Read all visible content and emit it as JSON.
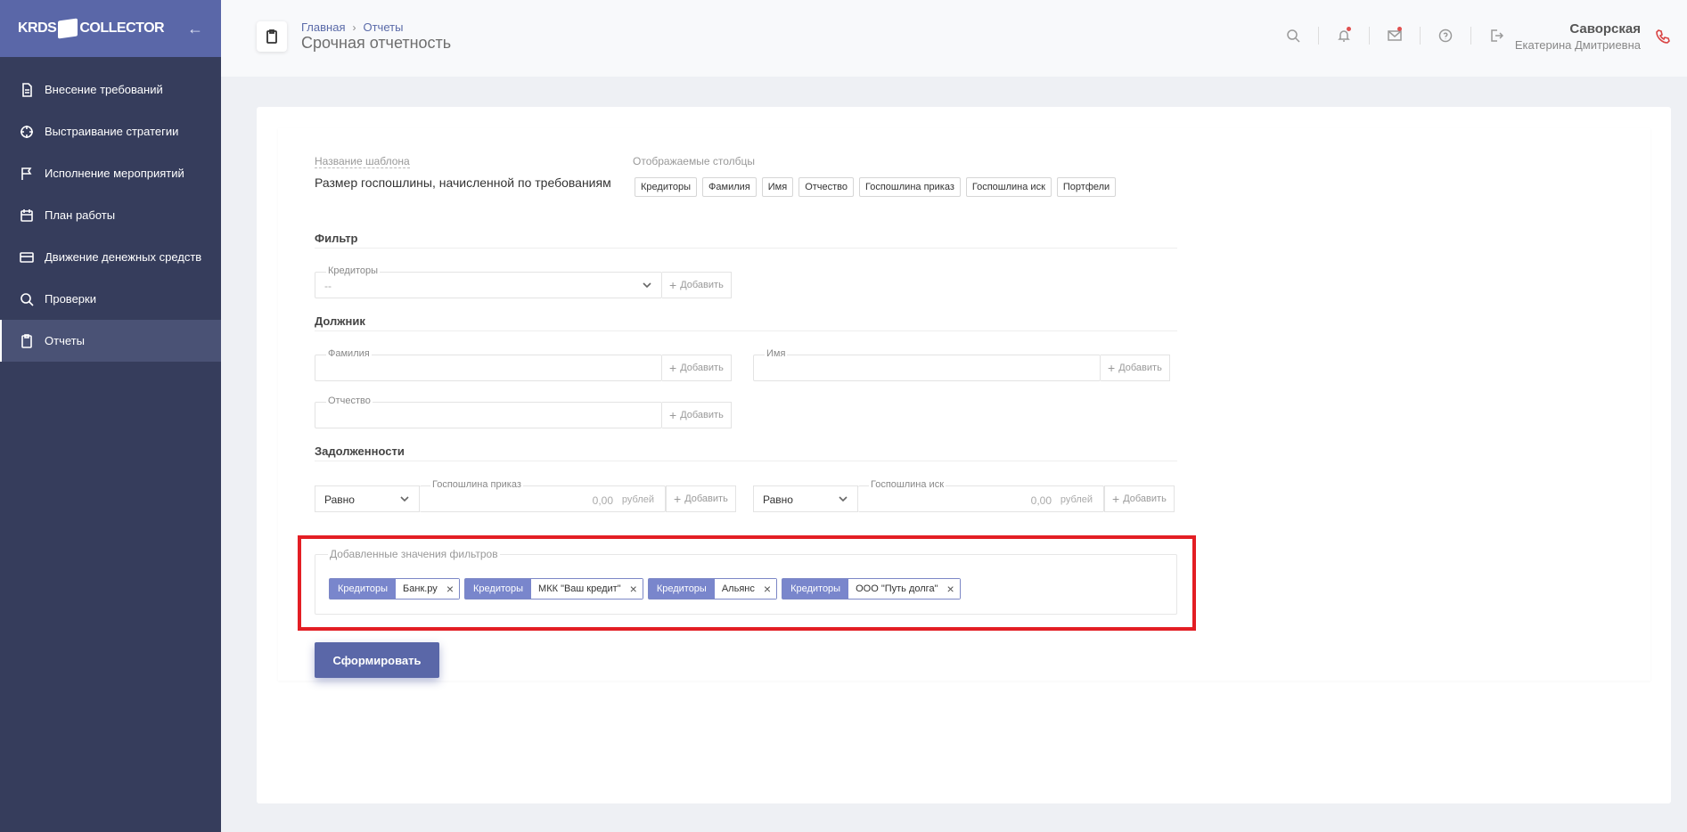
{
  "app": {
    "logo_left": "KRDS",
    "logo_right": "COLLECTOR"
  },
  "sidebar": {
    "items": [
      {
        "label": "Внесение требований",
        "icon": "document-icon"
      },
      {
        "label": "Выстраивание стратегии",
        "icon": "crosshair-icon"
      },
      {
        "label": "Исполнение мероприятий",
        "icon": "flag-icon"
      },
      {
        "label": "План работы",
        "icon": "calendar-icon"
      },
      {
        "label": "Движение денежных средств",
        "icon": "credit-card-icon"
      },
      {
        "label": "Проверки",
        "icon": "search-icon"
      },
      {
        "label": "Отчеты",
        "icon": "clipboard-icon",
        "active": true
      }
    ]
  },
  "header": {
    "breadcrumb": [
      "Главная",
      "Отчеты"
    ],
    "title": "Срочная отчетность",
    "user_last_name": "Саворская",
    "user_first_names": "Екатерина Дмитриевна"
  },
  "template": {
    "name_label": "Название шаблона",
    "name_value": "Размер госпошлины, начисленной по требованиям",
    "columns_label": "Отображаемые столбцы",
    "columns": [
      "Кредиторы",
      "Фамилия",
      "Имя",
      "Отчество",
      "Госпошлина приказ",
      "Госпошлина иск",
      "Портфели"
    ]
  },
  "filter": {
    "title": "Фильтр",
    "creditors_label": "Кредиторы",
    "creditors_value": "--",
    "add_label": "Добавить"
  },
  "debtor": {
    "title": "Должник",
    "last_name_label": "Фамилия",
    "first_name_label": "Имя",
    "patronymic_label": "Отчество"
  },
  "debts": {
    "title": "Задолженности",
    "order_fee_label": "Госпошлина приказ",
    "suit_fee_label": "Госпошлина иск",
    "operator": "Равно",
    "amount": "0,00",
    "unit": "рублей"
  },
  "added_filters": {
    "legend": "Добавленные значения фильтров",
    "tags": [
      {
        "key": "Кредиторы",
        "value": "Банк.ру"
      },
      {
        "key": "Кредиторы",
        "value": "МКК \"Ваш кредит\""
      },
      {
        "key": "Кредиторы",
        "value": "Альянс"
      },
      {
        "key": "Кредиторы",
        "value": "ООО \"Путь долга\""
      }
    ]
  },
  "actions": {
    "submit_label": "Сформировать"
  },
  "colors": {
    "sidebar_bg": "#363d5c",
    "accent": "#5a67a8",
    "tag_key_bg": "#7986cc",
    "highlight": "#e31e24"
  }
}
